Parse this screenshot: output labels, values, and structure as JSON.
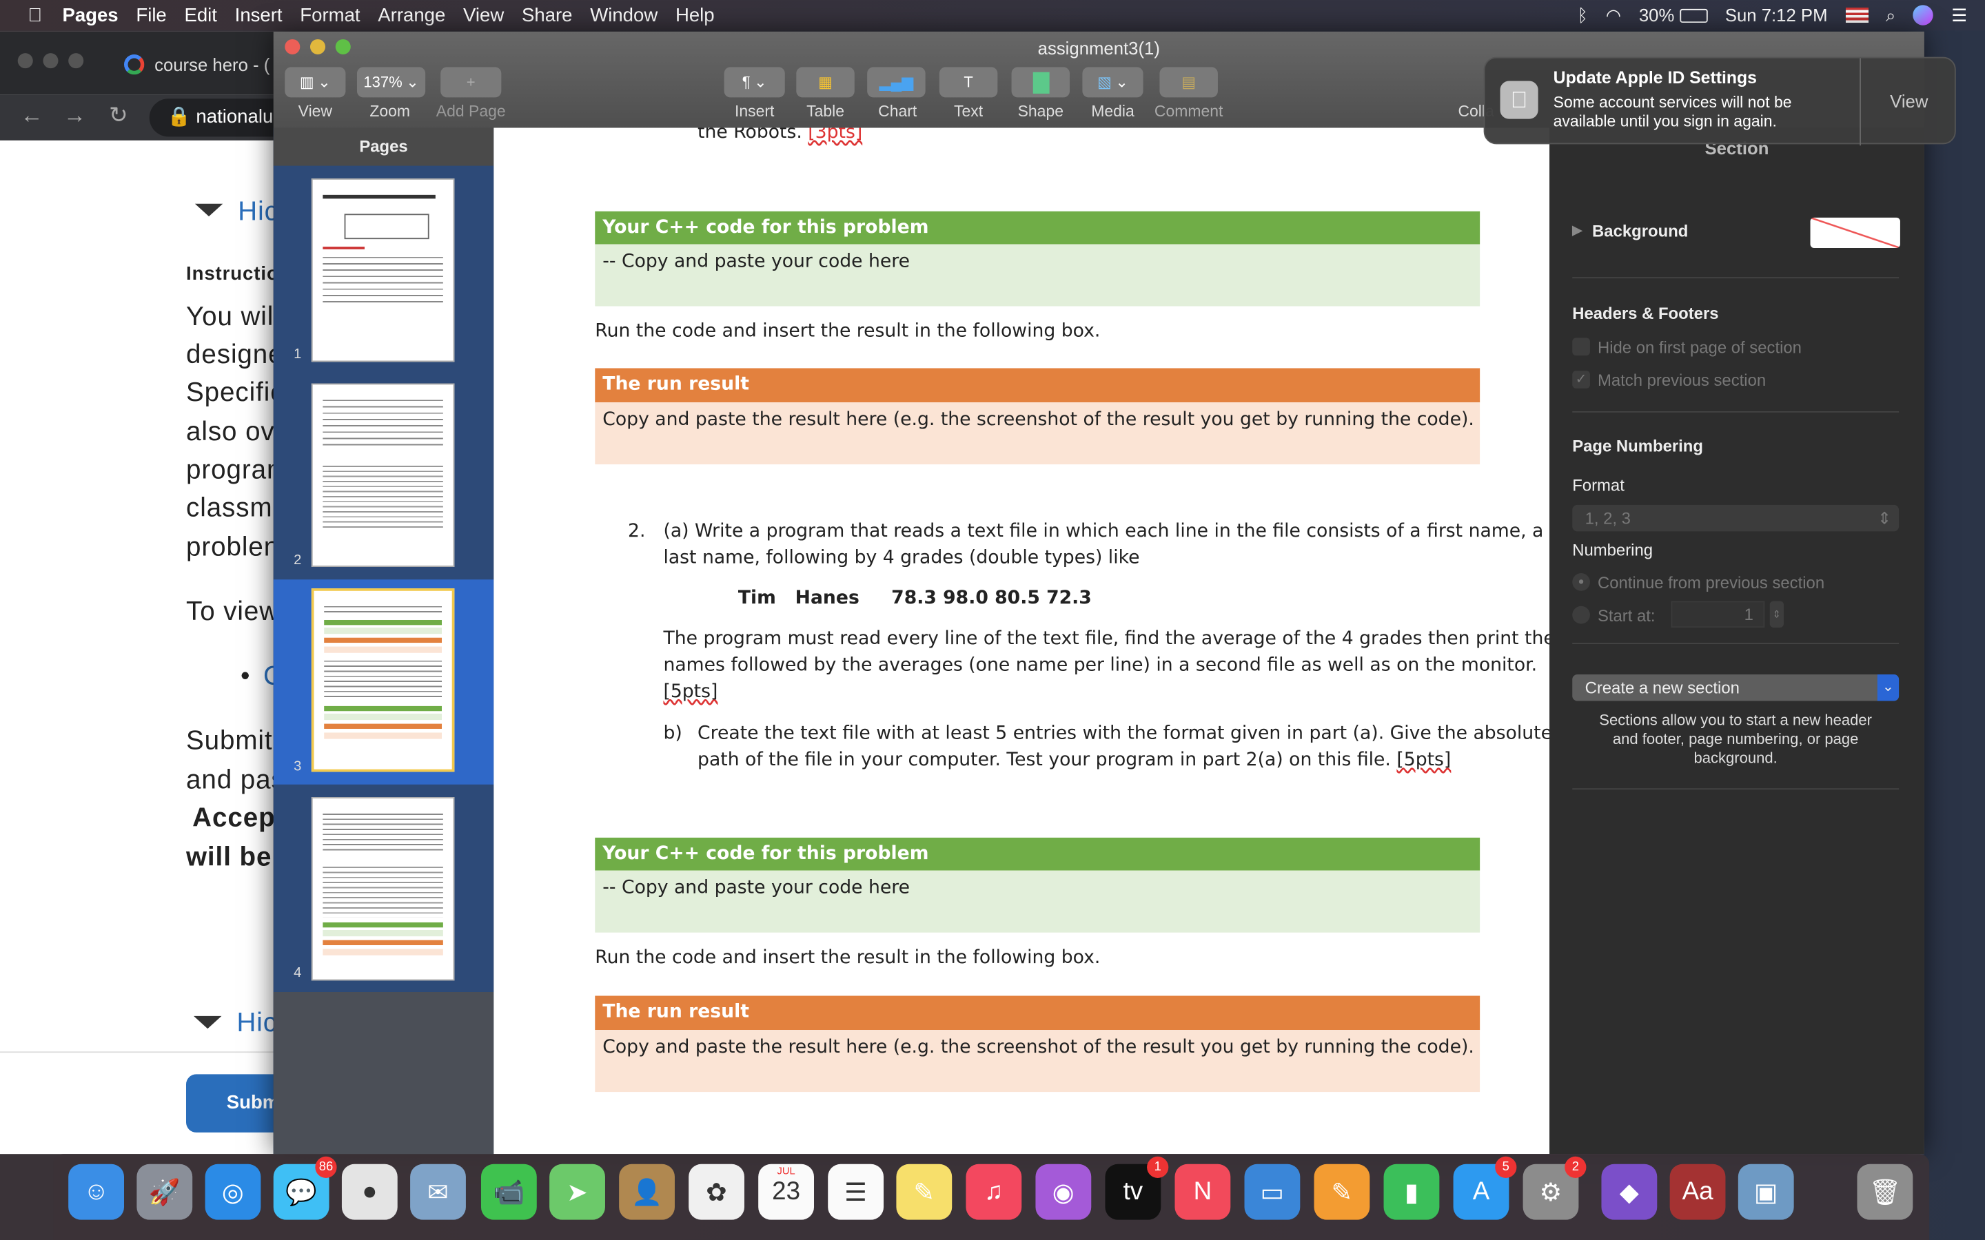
{
  "menubar": {
    "app": "Pages",
    "items": [
      "File",
      "Edit",
      "Insert",
      "Format",
      "Arrange",
      "View",
      "Share",
      "Window",
      "Help"
    ],
    "battery": "30%",
    "clock": "Sun 7:12 PM"
  },
  "browser": {
    "tab_title": "course hero - (",
    "address": "nationalu",
    "content": {
      "hide1": "Hic",
      "instructions": "Instructio",
      "lines": [
        "You wil",
        "designe",
        "Specific",
        "also ove",
        "program",
        "classma",
        "problen"
      ],
      "toview": "To view",
      "bullet": "C",
      "submit_lines": [
        "Submit",
        "and pas"
      ],
      "accept": "Accept",
      "willbe": "will be :",
      "hide2": "Hic",
      "submit_button": "Subm"
    }
  },
  "window": {
    "title": "assignment3(1)",
    "toolbar": {
      "view": "View",
      "zoom": "Zoom",
      "zoom_value": "137%",
      "add_page": "Add Page",
      "insert": "Insert",
      "table": "Table",
      "chart": "Chart",
      "text": "Text",
      "shape": "Shape",
      "media": "Media",
      "comment": "Comment",
      "collaborate": "Colla"
    }
  },
  "sidebar": {
    "title": "Pages",
    "pages": [
      "1",
      "2",
      "3",
      "4"
    ],
    "selected": "3"
  },
  "document": {
    "top_line": "the Robots.",
    "top_pts": "[3pts]",
    "code_header": "Your C++ code for this problem",
    "code_body": "--   Copy and paste your code here",
    "run_instr": "Run the code and insert the result in the following box.",
    "run_header": "The run result",
    "run_body": "Copy and paste the result here (e.g. the screenshot of the result you get by running the code).",
    "q2_num": "2.",
    "q2a_line1": "(a) Write a program that reads a text file in which each line in the file consists of a first name, a",
    "q2a_line2": "last name, following by 4 grades (double types) like",
    "example": "Tim   Hanes     78.3 98.0 80.5 72.3",
    "q2a_p1": "The program must read every line of the text file, find the average of the 4 grades then print the",
    "q2a_p2": "names followed by the averages (one name per line) in a second file as well as on the monitor.",
    "q2a_pts": "[5pts]",
    "q2b_label": "b)",
    "q2b_line1": "Create the text file with at least 5 entries with the format given in part (a). Give the absolute",
    "q2b_line2": "path of the file in your computer. Test your program in part 2(a) on this file.",
    "q2b_pts": "[5pts]"
  },
  "inspector": {
    "tab": "Section",
    "background": "Background",
    "headers_footers": "Headers & Footers",
    "hide_first": "Hide on first page of section",
    "match_prev": "Match previous section",
    "match_prev_checked": true,
    "hide_first_checked": false,
    "page_numbering": "Page Numbering",
    "format": "Format",
    "format_value": "1, 2, 3",
    "numbering": "Numbering",
    "continue": "Continue from previous section",
    "start_at": "Start at:",
    "start_value": "1",
    "create_section": "Create a new section",
    "section_help": "Sections allow you to start a new header and footer, page numbering, or page background."
  },
  "notification": {
    "title": "Update Apple ID Settings",
    "body1": "Some account services will not be",
    "body2": "available until you sign in again.",
    "action": "View"
  },
  "dock": {
    "items": [
      {
        "name": "finder",
        "glyph": "☺",
        "color": "#3a8ee6"
      },
      {
        "name": "launchpad",
        "glyph": "🚀",
        "color": "#8a8f99"
      },
      {
        "name": "safari",
        "glyph": "◎",
        "color": "#2b8be6"
      },
      {
        "name": "messages",
        "glyph": "💬",
        "color": "#3fbff5",
        "badge": "86"
      },
      {
        "name": "chrome",
        "glyph": "●",
        "color": "#e4e4e4"
      },
      {
        "name": "mail",
        "glyph": "✉",
        "color": "#7fa3c8"
      },
      {
        "name": "facetime",
        "glyph": "📹",
        "color": "#3fc24f"
      },
      {
        "name": "maps",
        "glyph": "➤",
        "color": "#6cc96a"
      },
      {
        "name": "contacts",
        "glyph": "👤",
        "color": "#b08850"
      },
      {
        "name": "photos",
        "glyph": "✿",
        "color": "#f0f0f0"
      },
      {
        "name": "calendar",
        "glyph": "23",
        "color": "#fafafa",
        "month": "JUL"
      },
      {
        "name": "reminders",
        "glyph": "☰",
        "color": "#fafafa"
      },
      {
        "name": "notes",
        "glyph": "✎",
        "color": "#f7df6b"
      },
      {
        "name": "music",
        "glyph": "♫",
        "color": "#f3485f"
      },
      {
        "name": "podcasts",
        "glyph": "◉",
        "color": "#a45ad8"
      },
      {
        "name": "tv",
        "glyph": "tv",
        "color": "#111",
        "badge": "1"
      },
      {
        "name": "news",
        "glyph": "N",
        "color": "#f24a5b"
      },
      {
        "name": "keynote",
        "glyph": "▭",
        "color": "#3a86d8"
      },
      {
        "name": "pages",
        "glyph": "✎",
        "color": "#f39c32"
      },
      {
        "name": "numbers",
        "glyph": "▮",
        "color": "#3bbf5a"
      },
      {
        "name": "app-store",
        "glyph": "A",
        "color": "#2d9af0",
        "badge": "5"
      },
      {
        "name": "system-preferences",
        "glyph": "⚙",
        "color": "#8c8c8c",
        "badge": "2"
      },
      {
        "name": "visual-studio",
        "glyph": "◆",
        "color": "#7b4fc9"
      },
      {
        "name": "dictionary",
        "glyph": "Aa",
        "color": "#a43232"
      },
      {
        "name": "preview",
        "glyph": "▣",
        "color": "#6e9ac4"
      },
      {
        "name": "trash",
        "glyph": "🗑",
        "color": "#8d8d8d"
      }
    ]
  }
}
